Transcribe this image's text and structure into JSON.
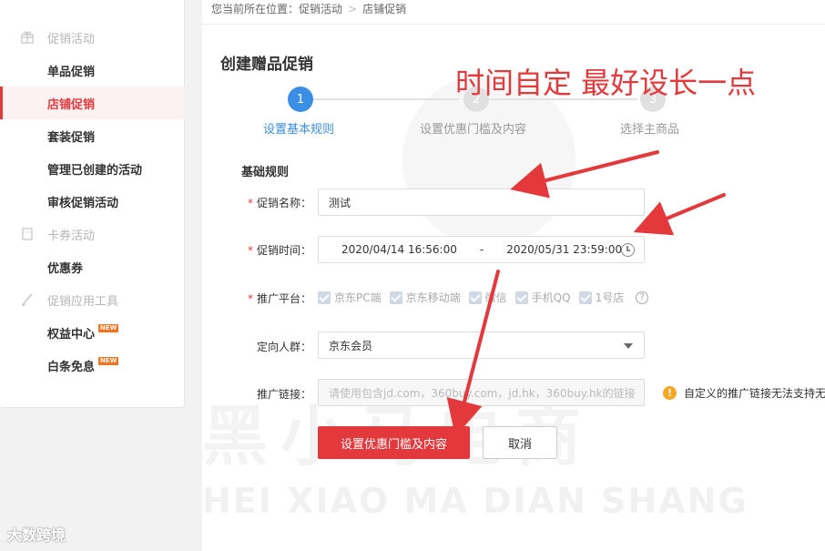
{
  "sidebar": {
    "groups": [
      {
        "label": "促销活动",
        "icon": "gift-icon",
        "items": [
          {
            "label": "单品促销",
            "active": false
          },
          {
            "label": "店铺促销",
            "active": true
          },
          {
            "label": "套装促销",
            "active": false
          },
          {
            "label": "管理已创建的活动",
            "active": false
          },
          {
            "label": "审核促销活动",
            "active": false
          }
        ]
      },
      {
        "label": "卡券活动",
        "icon": "coupon-icon",
        "items": [
          {
            "label": "优惠券",
            "active": false
          }
        ]
      },
      {
        "label": "促销应用工具",
        "icon": "brush-icon",
        "items": [
          {
            "label": "权益中心",
            "badge": "NEW"
          },
          {
            "label": "白条免息",
            "badge": "NEW"
          }
        ]
      }
    ]
  },
  "breadcrumb": {
    "prefix": "您当前所在位置：",
    "level1": "促销活动",
    "level2": "店铺促销"
  },
  "page": {
    "title": "创建赠品促销",
    "annotation": "时间自定  最好设长一点"
  },
  "steps": [
    {
      "num": "1",
      "label": "设置基本规则",
      "active": true
    },
    {
      "num": "2",
      "label": "设置优惠门槛及内容",
      "active": false
    },
    {
      "num": "3",
      "label": "选择主商品",
      "active": false
    }
  ],
  "form": {
    "section": "基础规则",
    "name_label": "促销名称：",
    "name_value": "测试",
    "time_label": "促销时间：",
    "time_start": "2020/04/14 16:56:00",
    "time_sep": "-",
    "time_end": "2020/05/31 23:59:00",
    "platform_label": "推广平台：",
    "platforms": [
      "京东PC端",
      "京东移动端",
      "微信",
      "手机QQ",
      "1号店"
    ],
    "help": "?",
    "audience_label": "定向人群：",
    "audience_value": "京东会员",
    "link_label": "推广链接：",
    "link_placeholder": "请使用包含jd.com，360buy.com，jd.hk，360buy.hk的链接",
    "warn_icon": "!",
    "warn_text": "自定义的推广链接无法支持无"
  },
  "buttons": {
    "primary": "设置优惠门槛及内容",
    "cancel": "取消"
  },
  "watermark": {
    "main": "黑小马电商",
    "sub": "HEI XIAO MA DIAN SHANG"
  },
  "corner_logo": "大数跨境",
  "colors": {
    "accent": "#e4393c",
    "step_active": "#3a8ee6"
  }
}
